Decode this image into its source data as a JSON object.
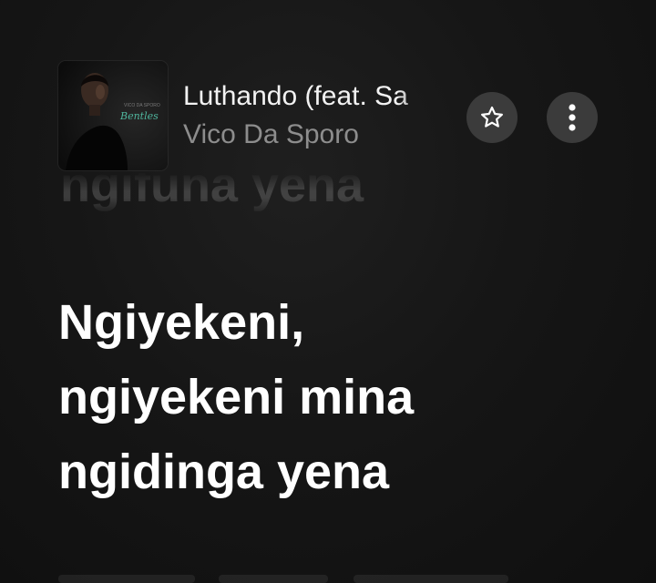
{
  "now_playing": {
    "title": "Luthando (feat. Sa",
    "artist": "Vico Da Sporo",
    "album_art": "album-cover-artist-portrait"
  },
  "actions": {
    "favorite_icon": "star-outline-icon",
    "more_icon": "more-vertical-icon"
  },
  "lyrics": {
    "previous_line": "ngifuna yena",
    "current_lines": [
      "Ngiyekeni,",
      "ngiyekeni mina",
      "ngidinga yena"
    ]
  },
  "colors": {
    "background": "#161616",
    "button_bg": "#3b3b3b",
    "lyric_active": "#ffffff",
    "artist_text": "#8d8d8d"
  }
}
